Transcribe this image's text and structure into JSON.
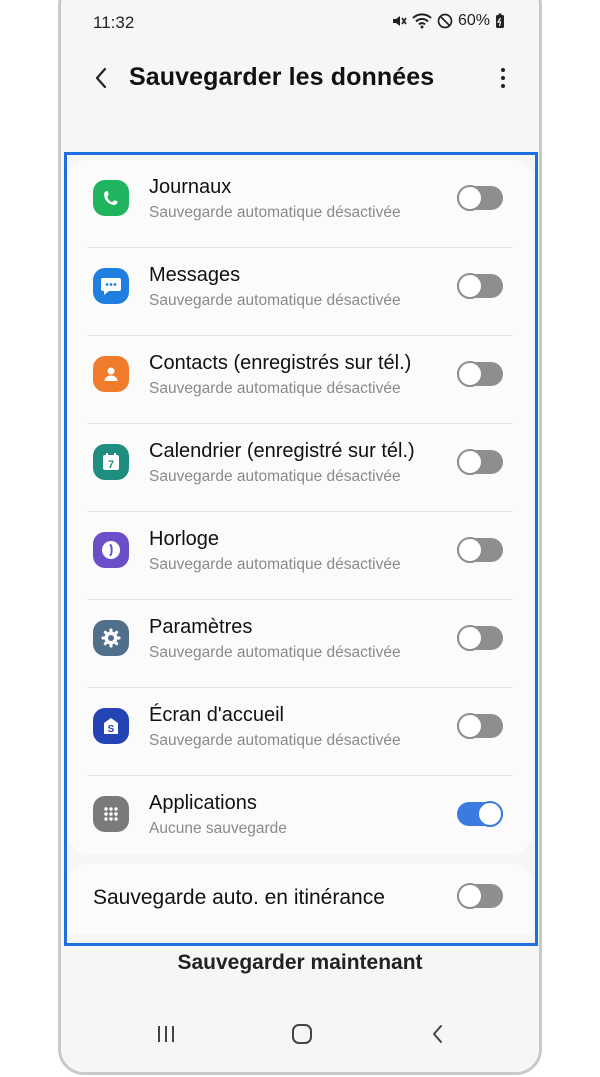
{
  "status_bar": {
    "time": "11:32",
    "battery": "60%"
  },
  "header": {
    "title": "Sauvegarder les données"
  },
  "items": [
    {
      "name": "Journaux",
      "sub": "Sauvegarde automatique désactivée",
      "icon": "phone-icon",
      "color": "#1fb45d",
      "enabled": false
    },
    {
      "name": "Messages",
      "sub": "Sauvegarde automatique désactivée",
      "icon": "message-icon",
      "color": "#1f7fe0",
      "enabled": false
    },
    {
      "name": "Contacts (enregistrés sur tél.)",
      "sub": "Sauvegarde automatique désactivée",
      "icon": "contact-icon",
      "color": "#f07b2a",
      "enabled": false
    },
    {
      "name": "Calendrier (enregistré sur tél.)",
      "sub": "Sauvegarde automatique désactivée",
      "icon": "calendar-icon",
      "color": "#1e8f7e",
      "enabled": false
    },
    {
      "name": "Horloge",
      "sub": "Sauvegarde automatique désactivée",
      "icon": "clock-icon",
      "color": "#6a4fc9",
      "enabled": false
    },
    {
      "name": "Paramètres",
      "sub": "Sauvegarde automatique désactivée",
      "icon": "gear-icon",
      "color": "#4f6f8a",
      "enabled": false
    },
    {
      "name": "Écran d'accueil",
      "sub": "Sauvegarde automatique désactivée",
      "icon": "home-screen-icon",
      "color": "#2344b5",
      "enabled": false
    },
    {
      "name": "Applications",
      "sub": "Aucune sauvegarde",
      "icon": "apps-grid-icon",
      "color": "#7a7a7a",
      "enabled": true
    }
  ],
  "roaming": {
    "label": "Sauvegarde auto. en itinérance",
    "enabled": false
  },
  "footer": {
    "backup_now_label": "Sauvegarder maintenant"
  },
  "colors": {
    "accent": "#3a7be0",
    "highlight": "#1f6fe0"
  }
}
